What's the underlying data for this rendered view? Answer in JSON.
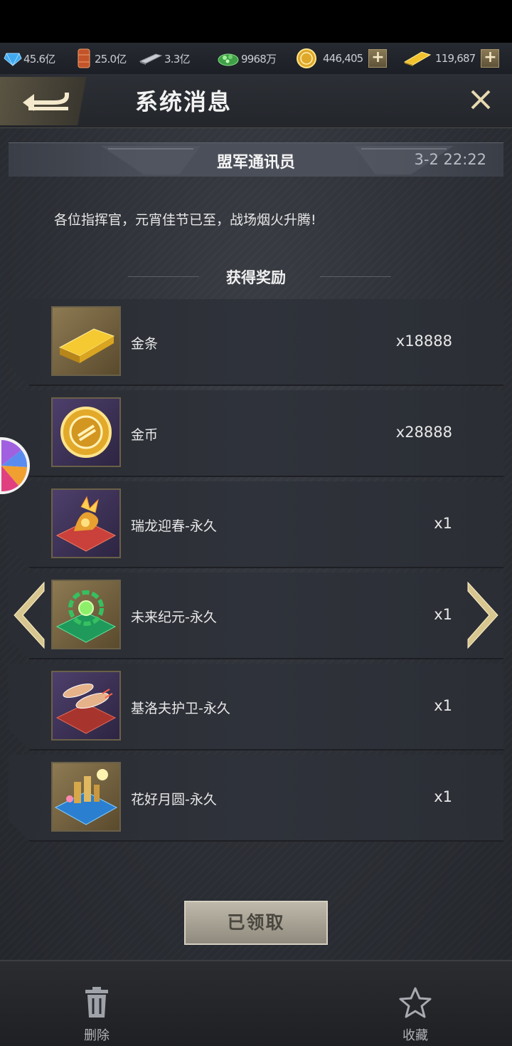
{
  "resources": [
    {
      "icon": "crystal-icon",
      "value": "45.6亿"
    },
    {
      "icon": "oil-barrel-icon",
      "value": "25.0亿"
    },
    {
      "icon": "steel-ingot-icon",
      "value": "3.3亿"
    },
    {
      "icon": "rare-earth-icon",
      "value": "9968万"
    },
    {
      "icon": "gold-coin-icon",
      "value": "446,405"
    },
    {
      "icon": "gold-bar-icon",
      "value": "119,687"
    }
  ],
  "header": {
    "title": "系统消息"
  },
  "mail": {
    "sender": "盟军通讯员",
    "time": "3-2 22:22",
    "message": "各位指挥官，元宵佳节已至，战场烟火升腾!",
    "rewards_title": "获得奖励"
  },
  "rewards": [
    {
      "name": "金条",
      "qty": "x18888",
      "icon": "gold-bar-icon"
    },
    {
      "name": "金币",
      "qty": "x28888",
      "icon": "gold-coin-icon"
    },
    {
      "name": "瑞龙迎春-永久",
      "qty": "x1",
      "icon": "dragon-skin-icon"
    },
    {
      "name": "未来纪元-永久",
      "qty": "x1",
      "icon": "future-era-skin-icon"
    },
    {
      "name": "基洛夫护卫-永久",
      "qty": "x1",
      "icon": "kirov-escort-skin-icon"
    },
    {
      "name": "花好月圆-永久",
      "qty": "x1",
      "icon": "full-moon-base-skin-icon"
    }
  ],
  "actions": {
    "claim": "已领取",
    "delete": "删除",
    "favorite": "收藏"
  }
}
